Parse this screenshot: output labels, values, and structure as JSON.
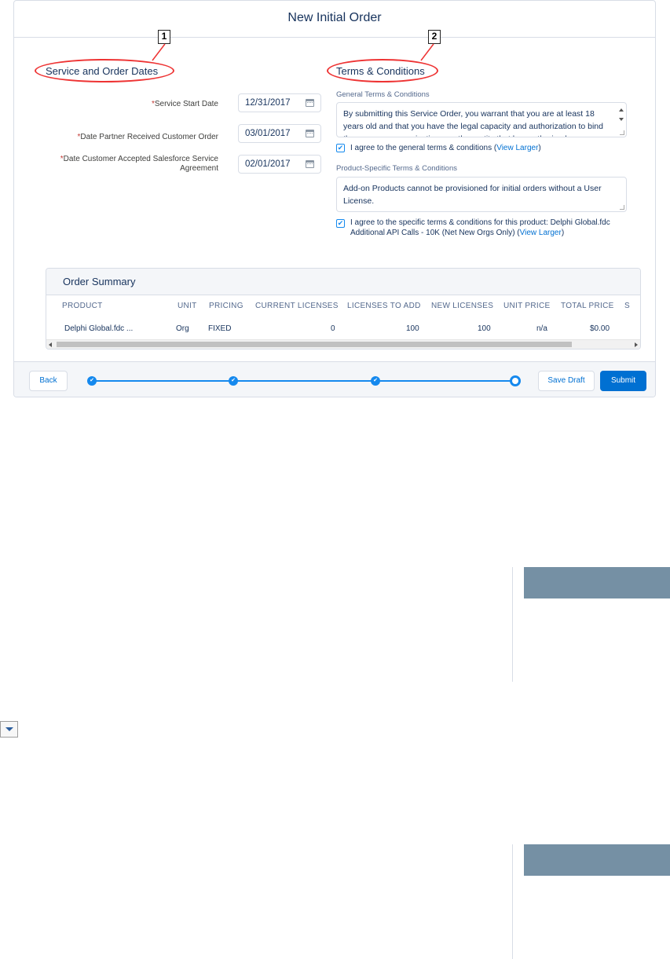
{
  "modal": {
    "title": "New Initial Order"
  },
  "callouts": [
    "1",
    "2"
  ],
  "dates_section": {
    "title": "Service and Order Dates",
    "required_marker": "*",
    "fields": [
      {
        "label": "Service Start Date",
        "value": "12/31/2017"
      },
      {
        "label": "Date Partner Received Customer Order",
        "value": "03/01/2017"
      },
      {
        "label_line1": "Date Customer Accepted Salesforce Service",
        "label_line2": "Agreement",
        "value": "02/01/2017"
      }
    ]
  },
  "terms_section": {
    "title": "Terms & Conditions",
    "general_label": "General Terms & Conditions",
    "general_text": "By submitting this Service Order, you warrant that you are at least 18 years old and that you have the legal capacity and authorization to bind the company, organization, or other entity that has authorized",
    "general_checkbox_text": "I agree to the general terms & conditions (",
    "view_larger": "View Larger",
    "close_paren": ")",
    "product_label": "Product-Specific Terms & Conditions",
    "product_text": "Add-on Products cannot be provisioned for initial orders without a User License.",
    "product_checkbox_text": "I agree to the specific terms & conditions for this product: Delphi Global.fdc Additional API Calls - 10K (Net New Orgs Only) ("
  },
  "order_summary": {
    "title": "Order Summary",
    "columns": [
      "PRODUCT",
      "UNIT",
      "PRICING",
      "CURRENT LICENSES",
      "LICENSES TO ADD",
      "NEW LICENSES",
      "UNIT PRICE",
      "TOTAL PRICE",
      "S"
    ],
    "row": {
      "product": "Delphi Global.fdc ...",
      "unit": "Org",
      "pricing": "FIXED",
      "current_licenses": "0",
      "licenses_to_add": "100",
      "new_licenses": "100",
      "unit_price": "n/a",
      "total_price": "$0.00"
    }
  },
  "footer": {
    "back_label": "Back",
    "save_draft_label": "Save Draft",
    "submit_label": "Submit",
    "steps_completed": 3,
    "steps_total": 4
  },
  "colors": {
    "brand": "#0070d2",
    "step_blue": "#1589ee",
    "callout_red": "#e33333",
    "panel_bar": "#7590a4"
  }
}
